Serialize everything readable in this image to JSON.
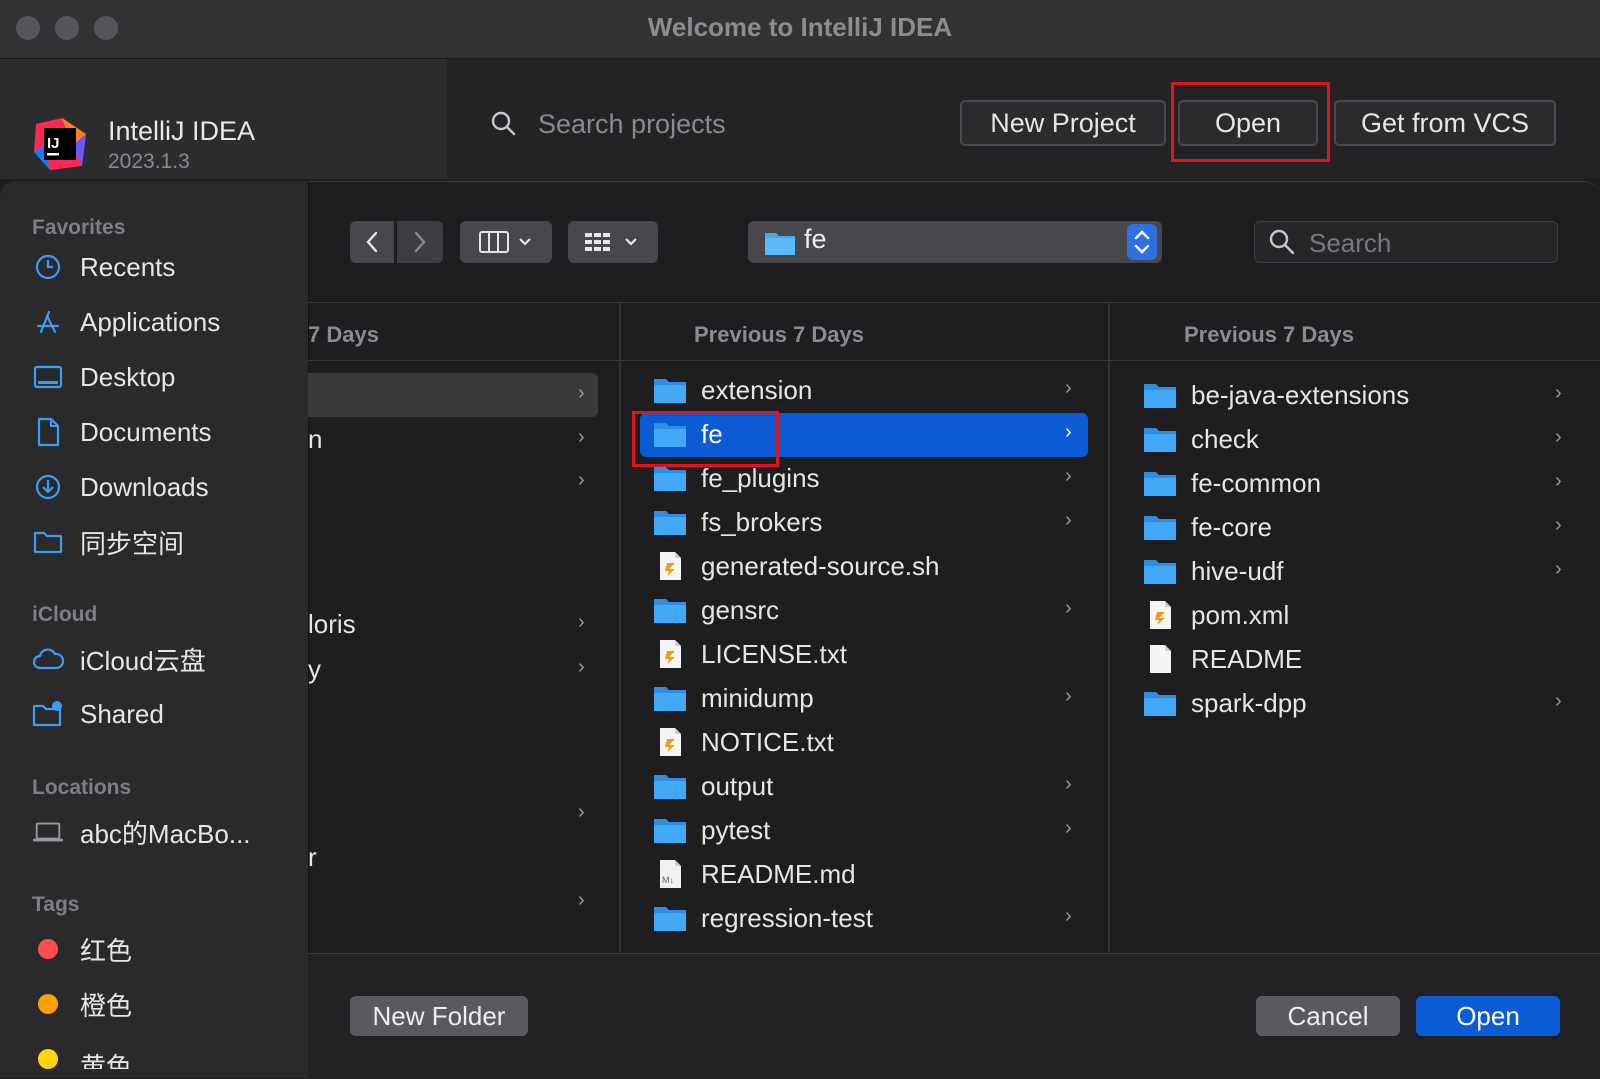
{
  "window": {
    "title": "Welcome to IntelliJ IDEA"
  },
  "welcome": {
    "app_name": "IntelliJ IDEA",
    "app_version": "2023.1.3",
    "search_placeholder": "Search projects",
    "buttons": {
      "new_project": "New Project",
      "open": "Open",
      "get_from_vcs": "Get from VCS"
    }
  },
  "dialog": {
    "path": "fe",
    "search_placeholder": "Search",
    "sidebar": {
      "favorites_header": "Favorites",
      "favorites": [
        {
          "label": "Recents",
          "icon": "clock-icon"
        },
        {
          "label": "Applications",
          "icon": "applications-icon"
        },
        {
          "label": "Desktop",
          "icon": "desktop-icon"
        },
        {
          "label": "Documents",
          "icon": "document-icon"
        },
        {
          "label": "Downloads",
          "icon": "download-icon"
        },
        {
          "label": "同步空间",
          "icon": "folder-icon"
        }
      ],
      "icloud_header": "iCloud",
      "icloud": [
        {
          "label": "iCloud云盘",
          "icon": "cloud-icon"
        },
        {
          "label": "Shared",
          "icon": "shared-folder-icon"
        }
      ],
      "locations_header": "Locations",
      "locations": [
        {
          "label": "abc的MacBo...",
          "icon": "laptop-icon"
        }
      ],
      "tags_header": "Tags",
      "tags": [
        {
          "label": "红色",
          "color": "#ff4d4d"
        },
        {
          "label": "橙色",
          "color": "#ff9f0a"
        },
        {
          "label": "黄色",
          "color": "#ffd60a"
        }
      ]
    },
    "columns": [
      {
        "header": "7 Days",
        "fragments": [
          "",
          "n",
          "",
          "loris",
          "y",
          "",
          "r",
          ""
        ]
      },
      {
        "header": "Previous 7 Days",
        "items": [
          {
            "name": "extension",
            "type": "folder",
            "has_children": true
          },
          {
            "name": "fe",
            "type": "folder",
            "has_children": true,
            "selected": true
          },
          {
            "name": "fe_plugins",
            "type": "folder",
            "has_children": true
          },
          {
            "name": "fs_brokers",
            "type": "folder",
            "has_children": true
          },
          {
            "name": "generated-source.sh",
            "type": "script",
            "has_children": false
          },
          {
            "name": "gensrc",
            "type": "folder",
            "has_children": true
          },
          {
            "name": "LICENSE.txt",
            "type": "script",
            "has_children": false
          },
          {
            "name": "minidump",
            "type": "folder",
            "has_children": true
          },
          {
            "name": "NOTICE.txt",
            "type": "script",
            "has_children": false
          },
          {
            "name": "output",
            "type": "folder",
            "has_children": true
          },
          {
            "name": "pytest",
            "type": "folder",
            "has_children": true
          },
          {
            "name": "README.md",
            "type": "markdown",
            "has_children": false
          },
          {
            "name": "regression-test",
            "type": "folder",
            "has_children": true
          }
        ]
      },
      {
        "header": "Previous 7 Days",
        "items": [
          {
            "name": "be-java-extensions",
            "type": "folder",
            "has_children": true
          },
          {
            "name": "check",
            "type": "folder",
            "has_children": true
          },
          {
            "name": "fe-common",
            "type": "folder",
            "has_children": true
          },
          {
            "name": "fe-core",
            "type": "folder",
            "has_children": true
          },
          {
            "name": "hive-udf",
            "type": "folder",
            "has_children": true
          },
          {
            "name": "pom.xml",
            "type": "script",
            "has_children": false
          },
          {
            "name": "README",
            "type": "document",
            "has_children": false
          },
          {
            "name": "spark-dpp",
            "type": "folder",
            "has_children": true
          }
        ]
      }
    ],
    "buttons": {
      "new_folder": "New Folder",
      "cancel": "Cancel",
      "open": "Open"
    }
  },
  "colors": {
    "accent": "#0b5bd5",
    "highlight": "#e0141b",
    "folder": "#41a9f5"
  }
}
